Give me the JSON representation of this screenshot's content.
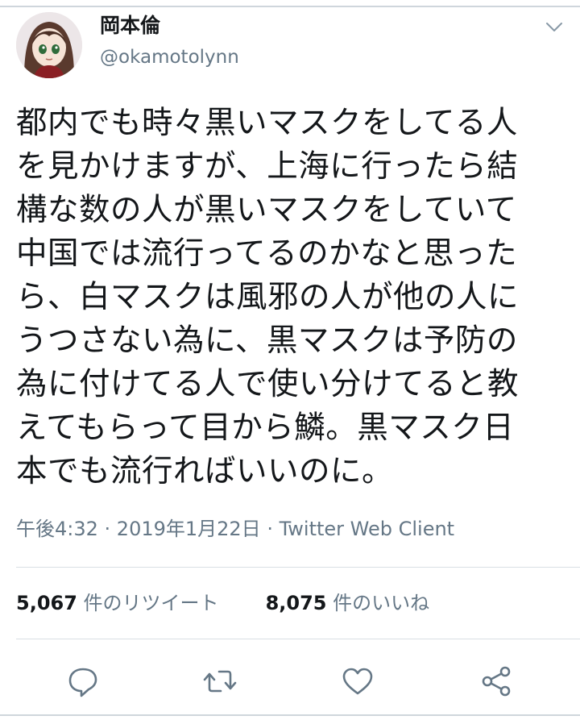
{
  "author": {
    "display_name": "岡本倫",
    "handle": "@okamotolynn",
    "avatar_icon": "avatar-anime-girl-icon"
  },
  "menu_icon": "chevron-down-icon",
  "tweet": {
    "text": "都内でも時々黒いマスクをしてる人\nを見かけますが、上海に行ったら結\n構な数の人が黒いマスクをしていて\n中国では流行ってるのかなと思った\nら、白マスクは風邪の人が他の人に\nうつさない為に、黒マスクは予防の\n為に付けてる人で使い分けてると教\nえてもらって目から鱗。黒マスク日\n本でも流行ればいいのに。",
    "time": "午後4:32",
    "separator": " · ",
    "date": "2019年1月22日",
    "source": "Twitter Web Client"
  },
  "stats": {
    "retweets_count": "5,067",
    "retweets_label": " 件のリツイート",
    "likes_count": "8,075",
    "likes_label": " 件のいいね"
  },
  "actions": {
    "reply_icon": "reply-icon",
    "retweet_icon": "retweet-icon",
    "like_icon": "heart-icon",
    "share_icon": "share-icon"
  },
  "colors": {
    "text": "#14171a",
    "secondary": "#657786",
    "icon": "#657786",
    "divider": "#d9dfe4"
  }
}
